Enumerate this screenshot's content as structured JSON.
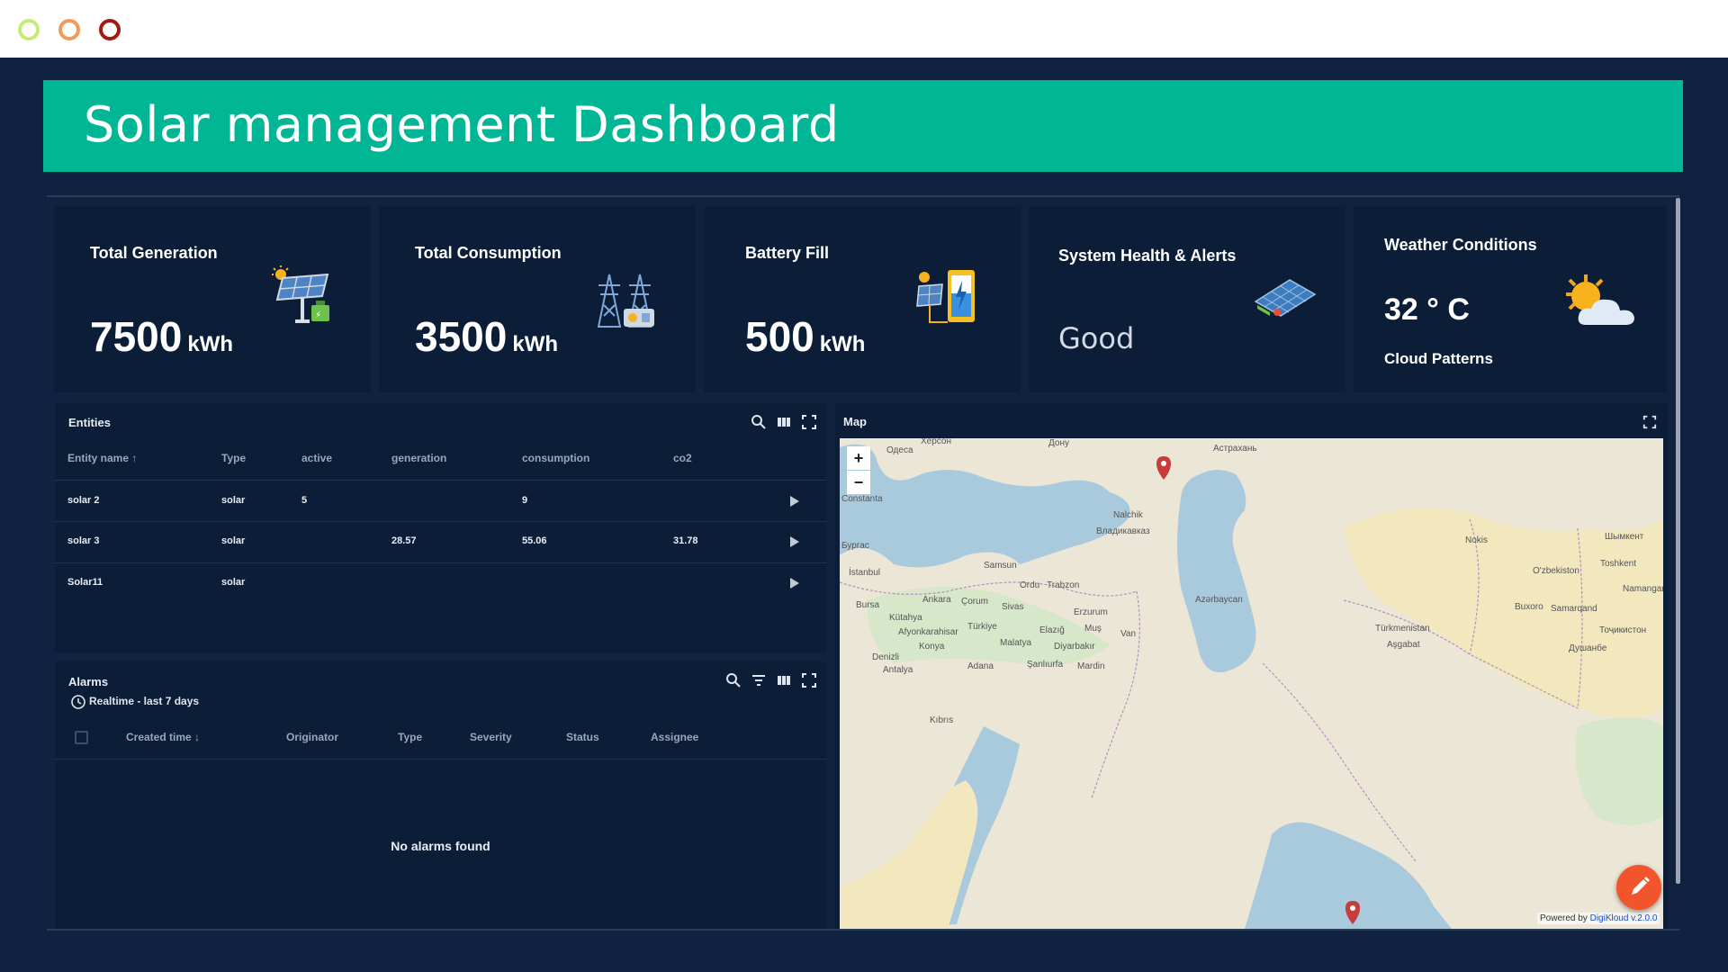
{
  "window": {
    "controls": [
      "minimize",
      "maximize",
      "close"
    ]
  },
  "page": {
    "title": "Solar management Dashboard"
  },
  "cards": [
    {
      "title": "Total Generation",
      "value": "7500",
      "unit": "kWh",
      "icon": "solar-panel-charging-icon"
    },
    {
      "title": "Total Consumption",
      "value": "3500",
      "unit": "kWh",
      "icon": "power-tower-icon"
    },
    {
      "title": "Battery Fill",
      "value": "500",
      "unit": "kWh",
      "icon": "battery-charging-icon"
    },
    {
      "title": "System Health & Alerts",
      "status": "Good",
      "icon": "solar-array-icon"
    },
    {
      "title": "Weather Conditions",
      "temperature": "32",
      "temp_unit": "° C",
      "description": "Cloud Patterns",
      "icon": "sun-cloud-icon"
    }
  ],
  "entities": {
    "title": "Entities",
    "columns": [
      "Entity name",
      "Type",
      "active",
      "generation",
      "consumption",
      "co2"
    ],
    "sort_indicator": "↑",
    "rows": [
      {
        "name": "solar 2",
        "type": "solar",
        "active": "5",
        "generation": "",
        "consumption": "9",
        "co2": ""
      },
      {
        "name": "solar 3",
        "type": "solar",
        "active": "",
        "generation": "28.57",
        "consumption": "55.06",
        "co2": "31.78"
      },
      {
        "name": "Solar11",
        "type": "solar",
        "active": "",
        "generation": "",
        "consumption": "",
        "co2": ""
      }
    ]
  },
  "alarms": {
    "title": "Alarms",
    "timewindow": "Realtime - last 7 days",
    "columns": [
      "Created time",
      "Originator",
      "Type",
      "Severity",
      "Status",
      "Assignee"
    ],
    "sort_indicator": "↓",
    "empty_text": "No alarms found"
  },
  "map": {
    "title": "Map",
    "zoom_in": "+",
    "zoom_out": "−",
    "attribution_prefix": "Powered by",
    "attribution_link": "DigiKloud v.2.0.0",
    "labels": [
      "Херсон",
      "Одеса",
      "Дону",
      "Астрахань",
      "Constanta",
      "Nalchik",
      "Владикавказ",
      "Бургас",
      "İstanbul",
      "Samsun",
      "Ordu",
      "Trabzon",
      "Bursa",
      "Ankara",
      "Çorum",
      "Sivas",
      "Erzurum",
      "Azərbaycan",
      "Kütahya",
      "Afyonkarahisar",
      "Konya",
      "Türkiye",
      "Malatya",
      "Elazığ",
      "Muş",
      "Van",
      "Diyarbakır",
      "Denizli",
      "Antalya",
      "Adana",
      "Şanlıurfa",
      "Mardin",
      "Kıbrıs",
      "Nokis",
      "O'zbekiston",
      "Toshkent",
      "Türkmenistan",
      "Aşgabat",
      "Buxoro",
      "Samarqand",
      "Namangan",
      "Душанбе",
      "Шымкент",
      "Тоҷикистон"
    ],
    "colors": {
      "sea": "#a9c9dd",
      "land": "#ece6d7",
      "desert": "#f2e7bd",
      "green": "#d7e7c9",
      "border": "#b48fbf"
    }
  },
  "colors": {
    "background": "#0f2240",
    "panel": "#0c1d38",
    "accent": "#00b694",
    "fab": "#f2552c"
  }
}
